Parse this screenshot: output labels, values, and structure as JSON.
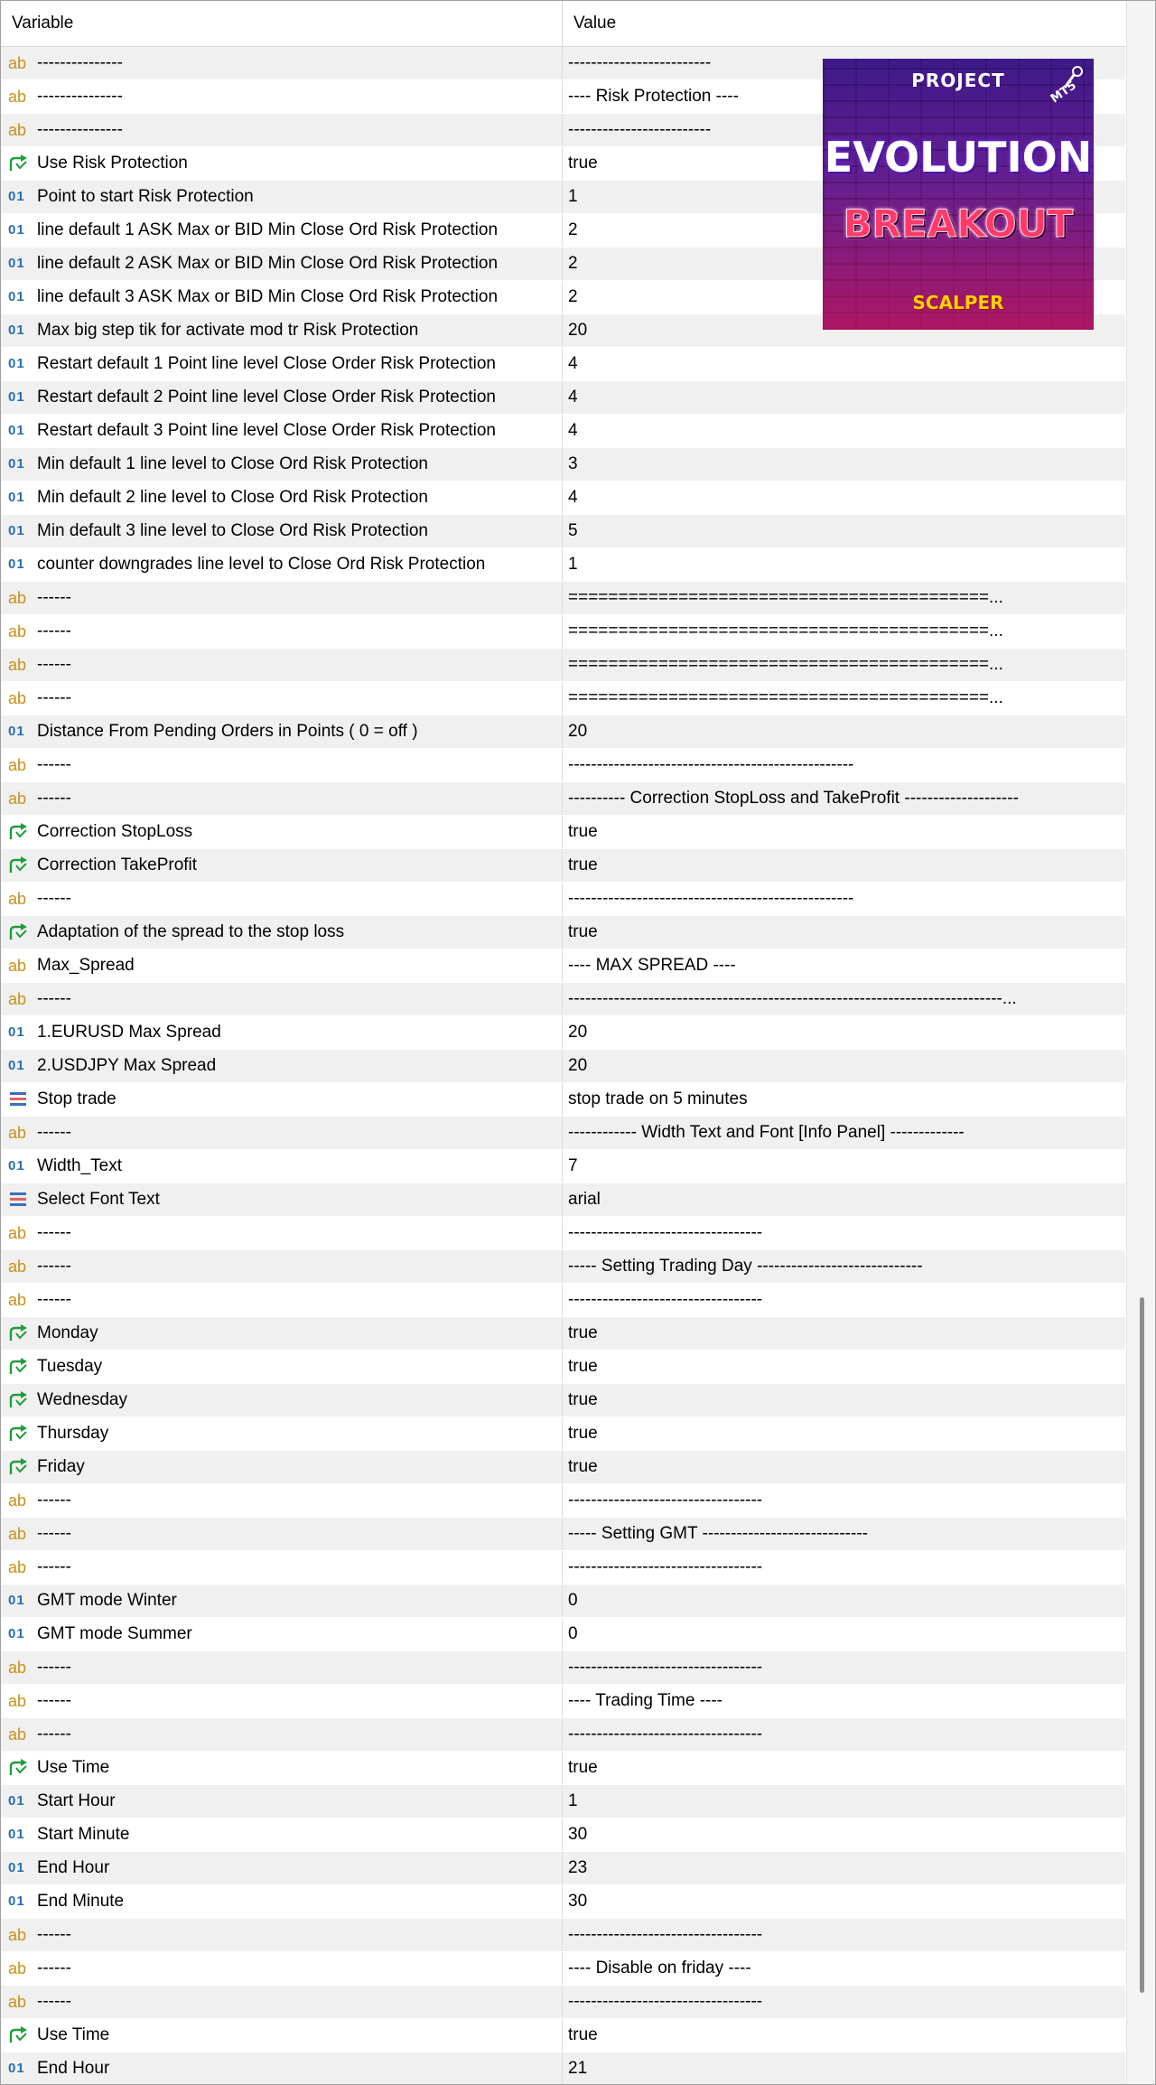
{
  "header": {
    "variable": "Variable",
    "value": "Value"
  },
  "rows": [
    {
      "type": "ab",
      "name": "---------------",
      "value": "-------------------------"
    },
    {
      "type": "ab",
      "name": "---------------",
      "value": "---- Risk Protection ----"
    },
    {
      "type": "ab",
      "name": "---------------",
      "value": "-------------------------"
    },
    {
      "type": "bool",
      "name": "Use Risk Protection",
      "value": "true"
    },
    {
      "type": "num",
      "name": "Point to start Risk Protection",
      "value": "1"
    },
    {
      "type": "num",
      "name": "line default 1 ASK Max or BID Min Close Ord Risk Protection",
      "value": "2"
    },
    {
      "type": "num",
      "name": "line default 2 ASK Max or BID Min Close Ord Risk Protection",
      "value": "2"
    },
    {
      "type": "num",
      "name": "line default 3 ASK Max or BID Min Close Ord Risk Protection",
      "value": "2"
    },
    {
      "type": "num",
      "name": "Max big step tik for activate mod tr Risk Protection",
      "value": "20"
    },
    {
      "type": "num",
      "name": "Restart default 1 Point line level Close Order Risk Protection",
      "value": "4"
    },
    {
      "type": "num",
      "name": "Restart default 2 Point line level Close Order Risk Protection",
      "value": "4"
    },
    {
      "type": "num",
      "name": "Restart default 3 Point line level Close Order Risk Protection",
      "value": "4"
    },
    {
      "type": "num",
      "name": "Min default 1 line level to Close Ord Risk Protection",
      "value": "3"
    },
    {
      "type": "num",
      "name": "Min default 2 line level to Close Ord Risk Protection",
      "value": "4"
    },
    {
      "type": "num",
      "name": "Min default 3 line level to Close Ord Risk Protection",
      "value": "5"
    },
    {
      "type": "num",
      "name": "counter downgrades line level to Close Ord Risk Protection",
      "value": "1"
    },
    {
      "type": "ab",
      "name": "------",
      "value": "==========================================..."
    },
    {
      "type": "ab",
      "name": "------",
      "value": "==========================================..."
    },
    {
      "type": "ab",
      "name": "------",
      "value": "==========================================..."
    },
    {
      "type": "ab",
      "name": "------",
      "value": "==========================================..."
    },
    {
      "type": "num",
      "name": "Distance From Pending Orders in Points ( 0 = off )",
      "value": "20"
    },
    {
      "type": "ab",
      "name": "------",
      "value": "--------------------------------------------------"
    },
    {
      "type": "ab",
      "name": "------",
      "value": "---------- Correction StopLoss and TakeProfit --------------------"
    },
    {
      "type": "bool",
      "name": "Correction StopLoss",
      "value": "true"
    },
    {
      "type": "bool",
      "name": "Correction TakeProfit",
      "value": "true"
    },
    {
      "type": "ab",
      "name": "------",
      "value": "--------------------------------------------------"
    },
    {
      "type": "bool",
      "name": "Adaptation of the spread to the stop loss",
      "value": "true"
    },
    {
      "type": "ab",
      "name": "Max_Spread",
      "value": "---- MAX SPREAD ----"
    },
    {
      "type": "ab",
      "name": "------",
      "value": "----------------------------------------------------------------------------..."
    },
    {
      "type": "num",
      "name": "1.EURUSD Max Spread",
      "value": "20"
    },
    {
      "type": "num",
      "name": "2.USDJPY Max Spread",
      "value": "20"
    },
    {
      "type": "enum",
      "name": "Stop trade",
      "value": "stop trade on 5 minutes"
    },
    {
      "type": "ab",
      "name": "------",
      "value": "------------ Width Text and Font [Info Panel] -------------"
    },
    {
      "type": "num",
      "name": "Width_Text",
      "value": "7"
    },
    {
      "type": "enum",
      "name": "Select Font Text",
      "value": "arial"
    },
    {
      "type": "ab",
      "name": "------",
      "value": "----------------------------------"
    },
    {
      "type": "ab",
      "name": "------",
      "value": "----- Setting Trading Day -----------------------------"
    },
    {
      "type": "ab",
      "name": "------",
      "value": "----------------------------------"
    },
    {
      "type": "bool",
      "name": "Monday",
      "value": "true"
    },
    {
      "type": "bool",
      "name": "Tuesday",
      "value": "true"
    },
    {
      "type": "bool",
      "name": "Wednesday",
      "value": "true"
    },
    {
      "type": "bool",
      "name": "Thursday",
      "value": "true"
    },
    {
      "type": "bool",
      "name": "Friday",
      "value": "true"
    },
    {
      "type": "ab",
      "name": "------",
      "value": "----------------------------------"
    },
    {
      "type": "ab",
      "name": "------",
      "value": "----- Setting GMT -----------------------------"
    },
    {
      "type": "ab",
      "name": "------",
      "value": "----------------------------------"
    },
    {
      "type": "num",
      "name": "GMT mode Winter",
      "value": "0"
    },
    {
      "type": "num",
      "name": "GMT mode Summer",
      "value": "0"
    },
    {
      "type": "ab",
      "name": "------",
      "value": "----------------------------------"
    },
    {
      "type": "ab",
      "name": "------",
      "value": "---- Trading Time ----"
    },
    {
      "type": "ab",
      "name": "------",
      "value": "----------------------------------"
    },
    {
      "type": "bool",
      "name": "Use Time",
      "value": "true"
    },
    {
      "type": "num",
      "name": "Start Hour",
      "value": "1"
    },
    {
      "type": "num",
      "name": "Start Minute",
      "value": "30"
    },
    {
      "type": "num",
      "name": "End Hour",
      "value": "23"
    },
    {
      "type": "num",
      "name": "End Minute",
      "value": "30"
    },
    {
      "type": "ab",
      "name": "------",
      "value": "----------------------------------"
    },
    {
      "type": "ab",
      "name": "------",
      "value": "---- Disable on friday ----"
    },
    {
      "type": "ab",
      "name": "------",
      "value": "----------------------------------"
    },
    {
      "type": "bool",
      "name": "Use Time",
      "value": "true"
    },
    {
      "type": "num",
      "name": "End Hour",
      "value": "21"
    }
  ],
  "icons": {
    "ab": "ab",
    "num": "01",
    "bool": "bool-arrow-icon",
    "enum": "enum-list-icon"
  },
  "logo": {
    "project": "PROJECT",
    "mt5": "MT5",
    "line1": "EVOLUTION",
    "line2": "BREAKOUT",
    "line3": "SCALPER"
  },
  "colors": {
    "row_alt": "#f0f0f0",
    "ab_icon": "#c8901a",
    "num_icon": "#2a6db3",
    "bool_icon": "#1f9d3a",
    "enum_icon": "#3a6fc4"
  }
}
